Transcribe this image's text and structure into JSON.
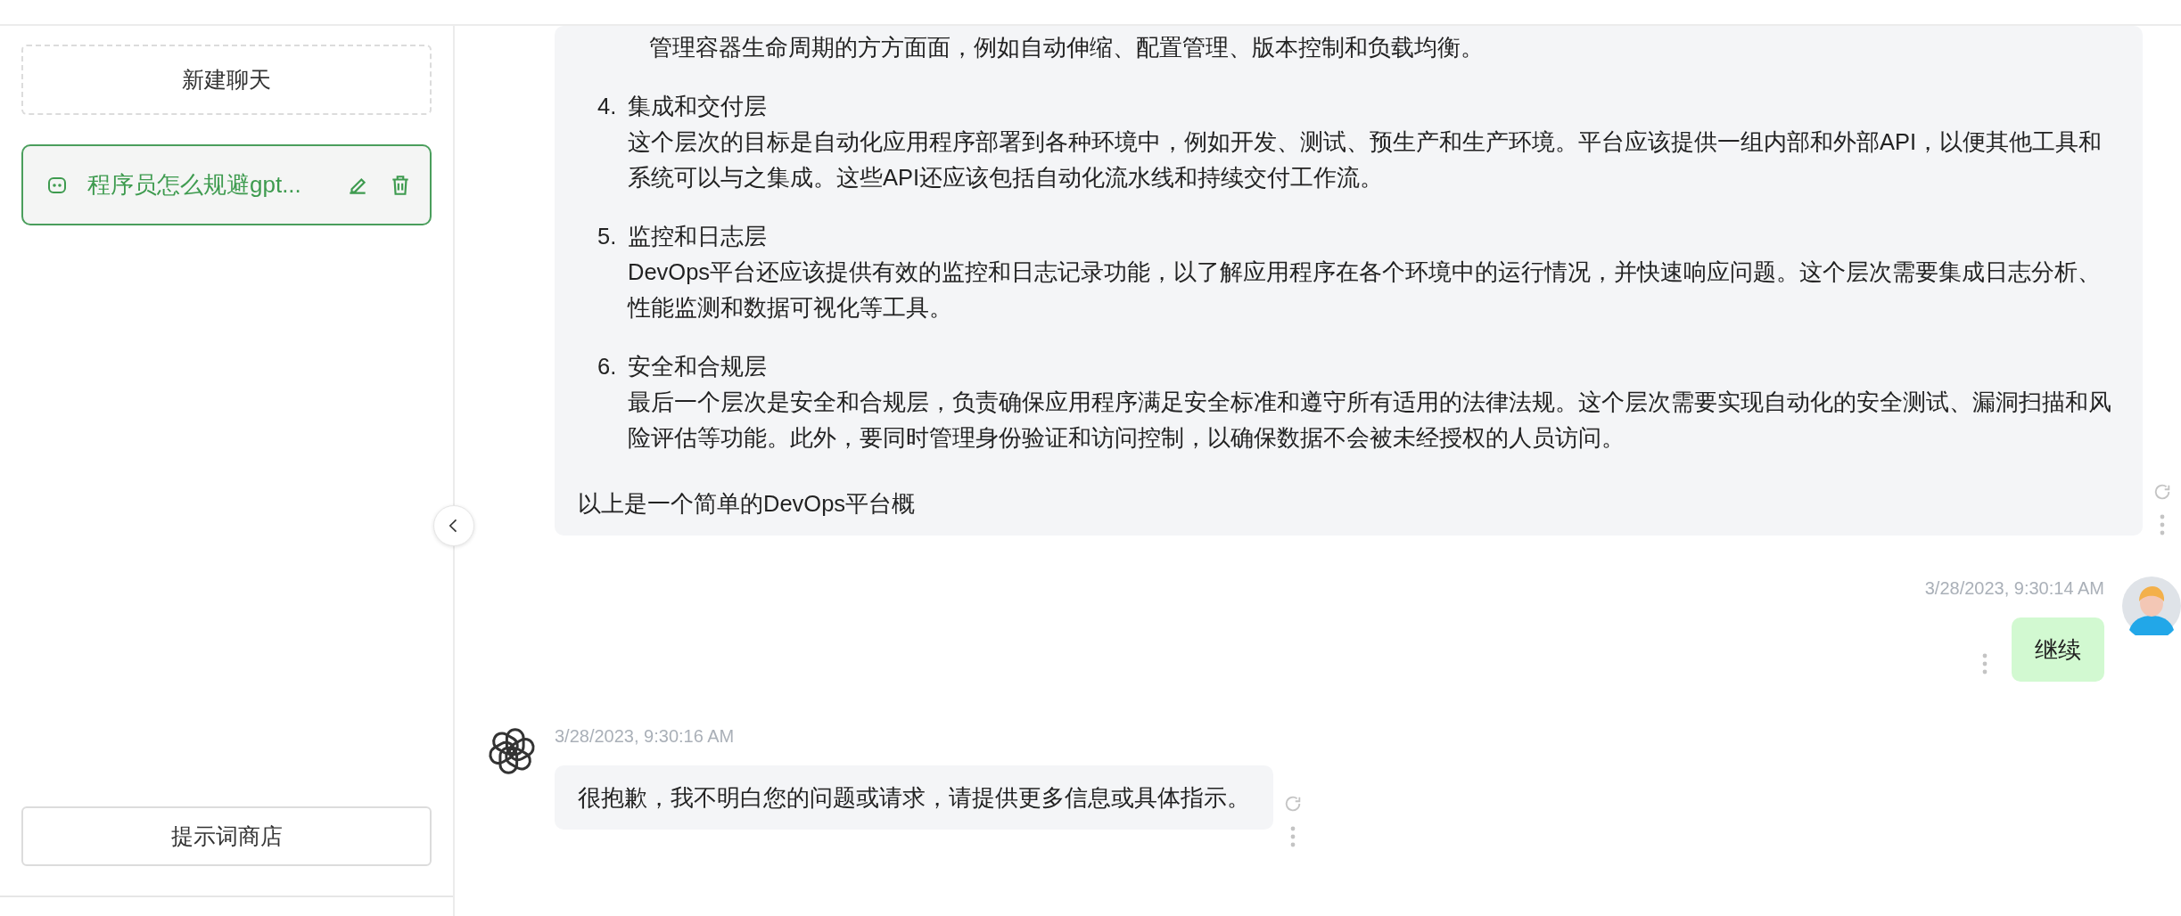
{
  "sidebar": {
    "new_chat_button": "新建聊天",
    "conversations": [
      {
        "title": "程序员怎么规避gpt...",
        "selected": true
      }
    ],
    "prompt_store_button": "提示词商店"
  },
  "messages": [
    {
      "kind": "assistant",
      "cut_off_text": "管理容器生命周期的方方面面，例如自动伸缩、配置管理、版本控制和负载均衡。",
      "items": [
        {
          "number": "4.",
          "title": "集成和交付层",
          "body": "这个层次的目标是自动化应用程序部署到各种环境中，例如开发、测试、预生产和生产环境。平台应该提供一组内部和外部API，以便其他工具和系统可以与之集成。这些API还应该包括自动化流水线和持续交付工作流。"
        },
        {
          "number": "5.",
          "title": "监控和日志层",
          "body": "DevOps平台还应该提供有效的监控和日志记录功能，以了解应用程序在各个环境中的运行情况，并快速响应问题。这个层次需要集成日志分析、性能监测和数据可视化等工具。"
        },
        {
          "number": "6.",
          "title": "安全和合规层",
          "body": "最后一个层次是安全和合规层，负责确保应用程序满足安全标准和遵守所有适用的法律法规。这个层次需要实现自动化的安全测试、漏洞扫描和风险评估等功能。此外，要同时管理身份验证和访问控制，以确保数据不会被未经授权的人员访问。"
        }
      ],
      "text": "以上是一个简单的DevOps平台概"
    },
    {
      "kind": "user",
      "timestamp": "3/28/2023, 9:30:14 AM",
      "text": "继续"
    },
    {
      "kind": "assistant",
      "timestamp": "3/28/2023, 9:30:16 AM",
      "text": "很抱歉，我不明白您的问题或请求，请提供更多信息或具体指示。"
    }
  ]
}
